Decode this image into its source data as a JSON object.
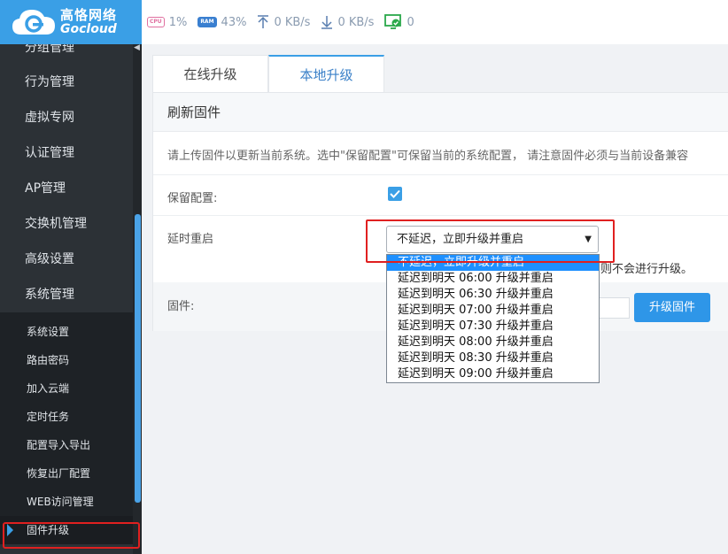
{
  "logo": {
    "cn": "高恪网络",
    "en": "Gocloud"
  },
  "topbar": {
    "cpu": {
      "icon": "cpu-icon",
      "label": "CPU",
      "value": "1%"
    },
    "ram": {
      "icon": "ram-icon",
      "label": "RAM",
      "value": "43%"
    },
    "upload": {
      "icon": "upload-arrow-icon",
      "value": "0 KB/s"
    },
    "download": {
      "icon": "download-arrow-icon",
      "value": "0 KB/s"
    },
    "devices": {
      "icon": "monitor-check-icon",
      "value": "0"
    }
  },
  "sidebar": {
    "items": [
      {
        "label": "分组管理"
      },
      {
        "label": "行为管理"
      },
      {
        "label": "虚拟专网"
      },
      {
        "label": "认证管理"
      },
      {
        "label": "AP管理"
      },
      {
        "label": "交换机管理"
      },
      {
        "label": "高级设置"
      },
      {
        "label": "系统管理"
      }
    ],
    "submenu": [
      {
        "label": "系统设置"
      },
      {
        "label": "路由密码"
      },
      {
        "label": "加入云端"
      },
      {
        "label": "定时任务"
      },
      {
        "label": "配置导入导出"
      },
      {
        "label": "恢复出厂配置"
      },
      {
        "label": "WEB访问管理"
      },
      {
        "label": "固件升级"
      }
    ]
  },
  "tabs": [
    {
      "label": "在线升级"
    },
    {
      "label": "本地升级"
    }
  ],
  "panel": {
    "title": "刷新固件",
    "description": "请上传固件以更新当前系统。选中\"保留配置\"可保留当前的系统配置， 请注意固件必须与当前设备兼容",
    "keep_config_label": "保留配置:",
    "delay_reboot_label": "延时重启",
    "firmware_label": "固件:",
    "note_tail": "则不会进行升级。",
    "upgrade_button": "升级固件"
  },
  "select": {
    "value": "不延迟，立即升级并重启",
    "options": [
      "不延迟，立即升级并重启",
      "延迟到明天 06:00 升级并重启",
      "延迟到明天 06:30 升级并重启",
      "延迟到明天 07:00 升级并重启",
      "延迟到明天 07:30 升级并重启",
      "延迟到明天 08:00 升级并重启",
      "延迟到明天 08:30 升级并重启",
      "延迟到明天 09:00 升级并重启"
    ]
  },
  "colors": {
    "accent": "#3a9fe6",
    "sidebar_bg": "#2c3136",
    "highlight": "#e02020"
  }
}
